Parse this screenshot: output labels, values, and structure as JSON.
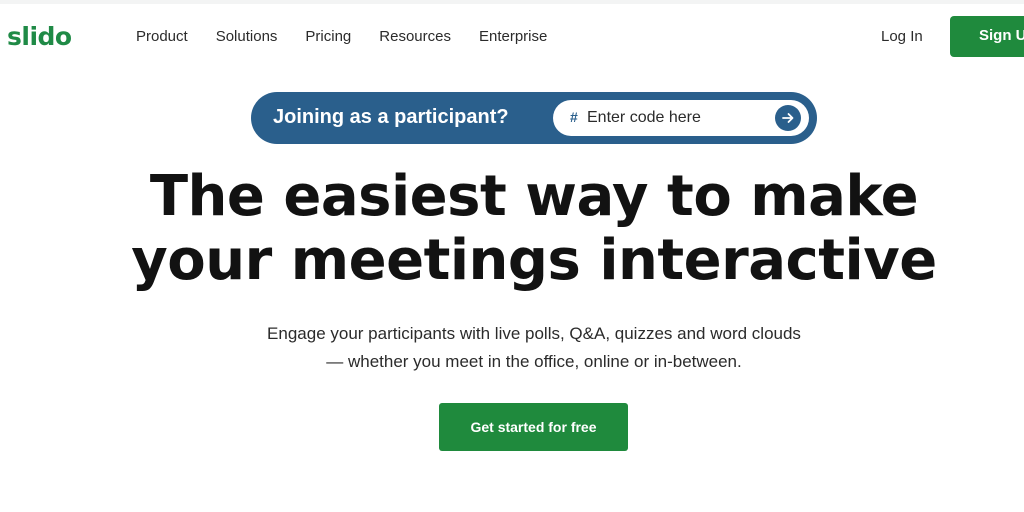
{
  "brand": {
    "logo_text": "slido",
    "accent_color": "#1f8a3d",
    "join_color": "#2a5f8c"
  },
  "nav": {
    "items": [
      {
        "label": "Product"
      },
      {
        "label": "Solutions"
      },
      {
        "label": "Pricing"
      },
      {
        "label": "Resources"
      },
      {
        "label": "Enterprise"
      }
    ],
    "login_label": "Log In",
    "signup_label": "Sign Up"
  },
  "join": {
    "label": "Joining as a participant?",
    "hash_symbol": "#",
    "placeholder": "Enter code here",
    "submit_icon": "arrow-right-icon"
  },
  "hero": {
    "headline_line1": "The easiest way to make",
    "headline_line2": "your meetings interactive",
    "sub_line1": "Engage your participants with live polls, Q&A, quizzes and word clouds",
    "sub_line2": "— whether you meet in the office, online or in-between.",
    "cta_label": "Get started for free"
  }
}
